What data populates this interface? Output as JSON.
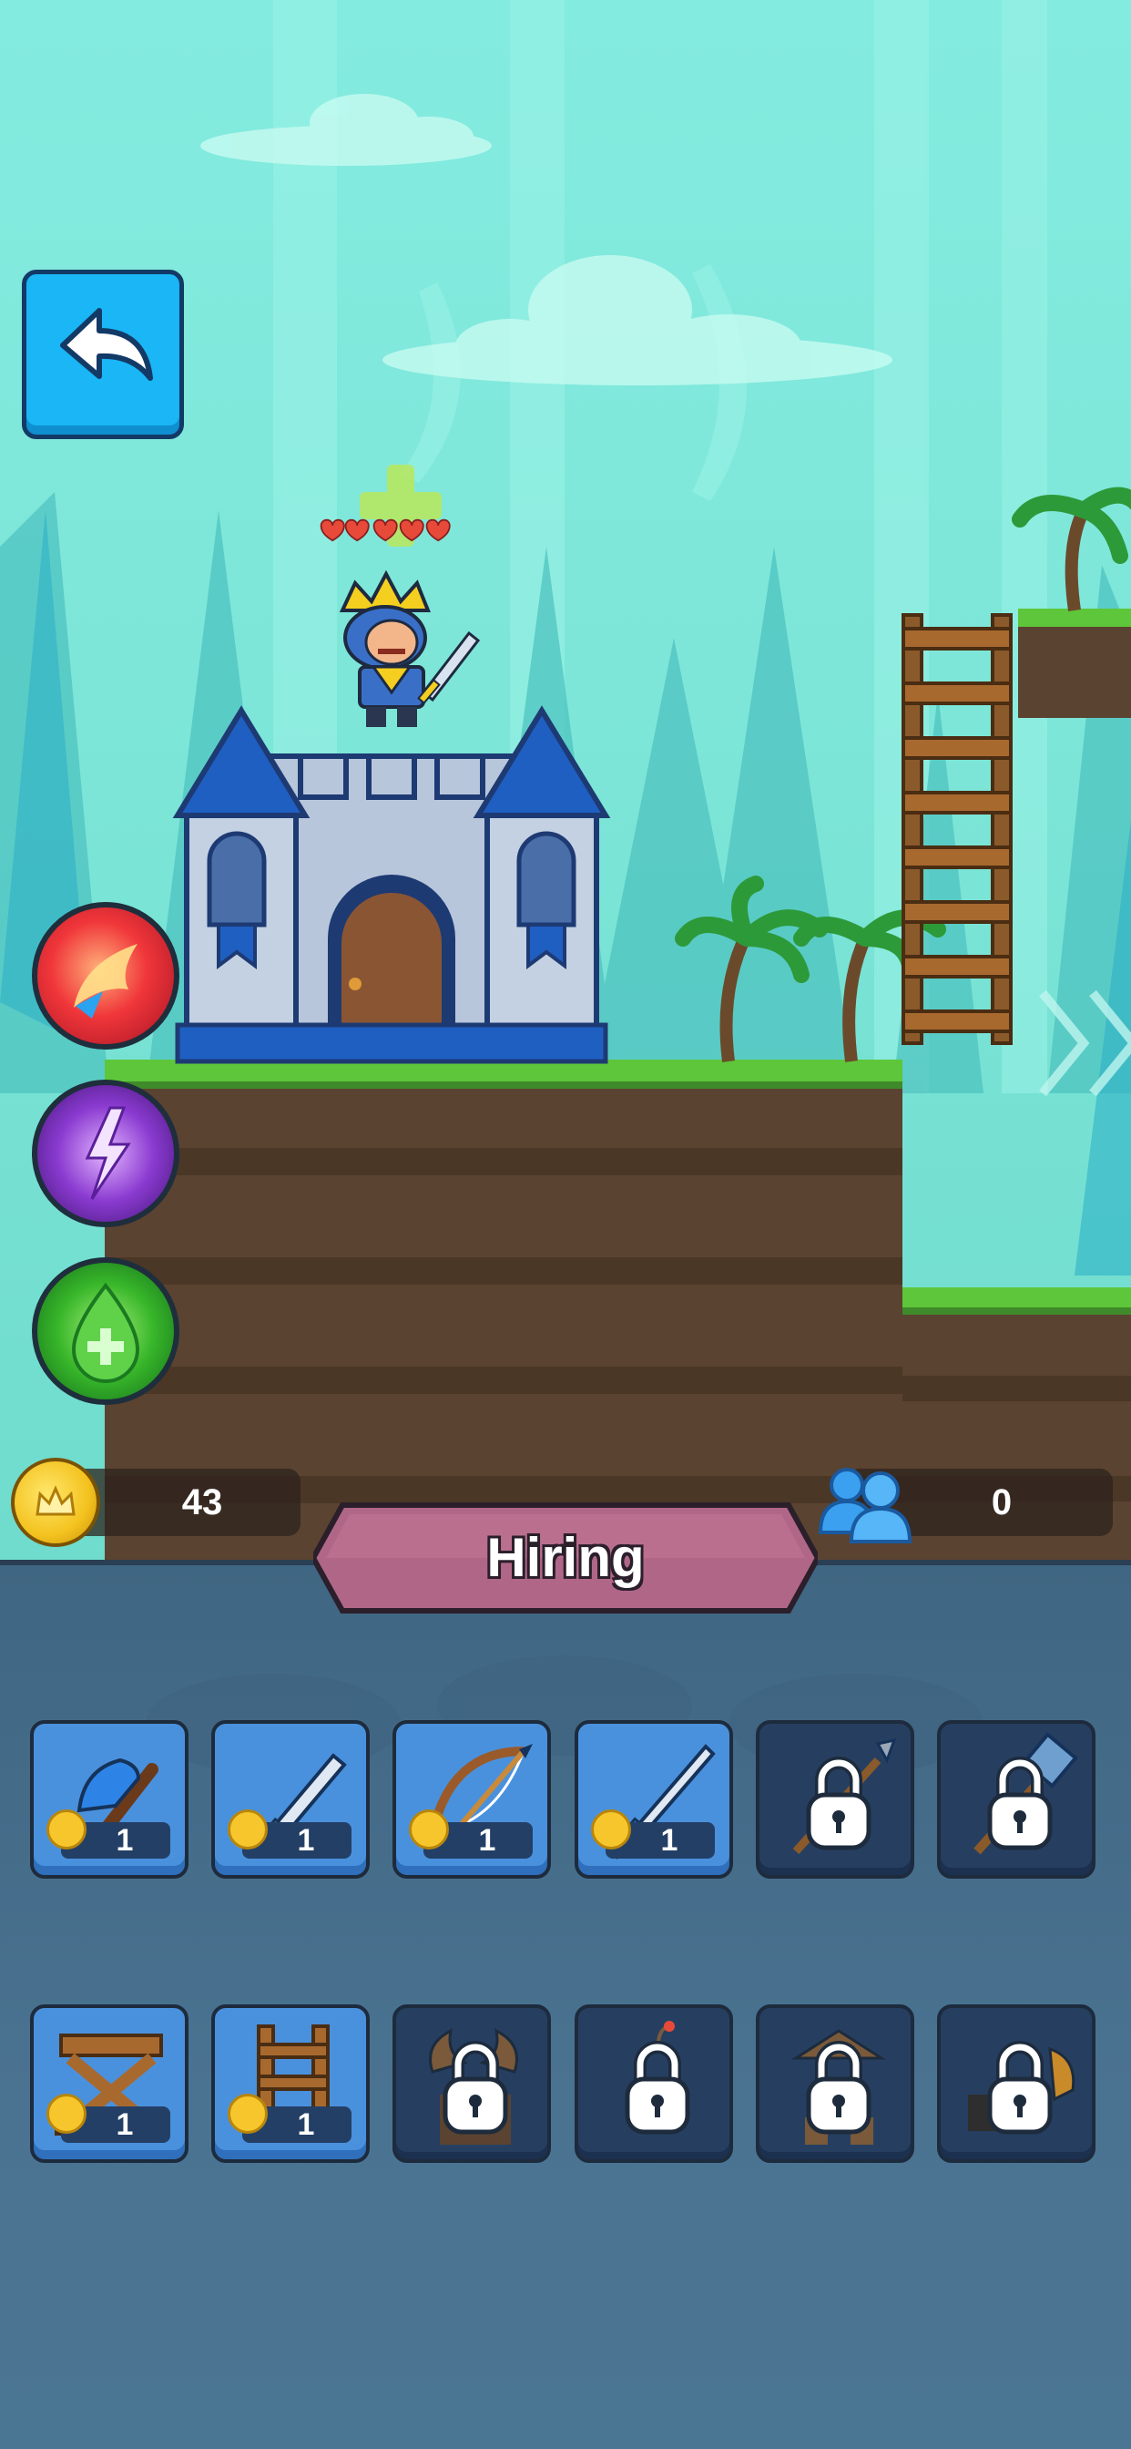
{
  "hud": {
    "coins": "43",
    "population": "0",
    "panel_title": "Hiring"
  },
  "buttons": {
    "back": "back-arrow-icon",
    "skills": [
      "fire-meteor-skill",
      "lightning-skill",
      "heal-skill"
    ]
  },
  "king": {
    "hearts": 5
  },
  "hiring_slots": [
    {
      "id": "axe",
      "icon": "axe-icon",
      "cost": "1",
      "locked": false
    },
    {
      "id": "sword",
      "icon": "sword-icon",
      "cost": "1",
      "locked": false
    },
    {
      "id": "bow",
      "icon": "bow-icon",
      "cost": "1",
      "locked": false
    },
    {
      "id": "long-sword",
      "icon": "long-sword-icon",
      "cost": "1",
      "locked": false
    },
    {
      "id": "spear",
      "icon": "spear-icon",
      "locked": true
    },
    {
      "id": "hammer",
      "icon": "hammer-icon",
      "locked": true
    },
    {
      "id": "barricade",
      "icon": "barricade-icon",
      "cost": "1",
      "locked": false
    },
    {
      "id": "ladder",
      "icon": "ladder-icon",
      "cost": "1",
      "locked": false
    },
    {
      "id": "horned-unit",
      "icon": "horns-icon",
      "locked": true
    },
    {
      "id": "bomb",
      "icon": "bomb-icon",
      "locked": true
    },
    {
      "id": "tower",
      "icon": "tower-icon",
      "locked": true
    },
    {
      "id": "cannon",
      "icon": "cannon-icon",
      "locked": true
    }
  ],
  "colors": {
    "sky": "#84ebe0",
    "grass": "#5ec63a",
    "dirt": "#5a4330",
    "panel": "#4a7391",
    "banner": "#b06787",
    "slot_unlocked": "#4a91dd",
    "slot_locked": "#263f61"
  }
}
